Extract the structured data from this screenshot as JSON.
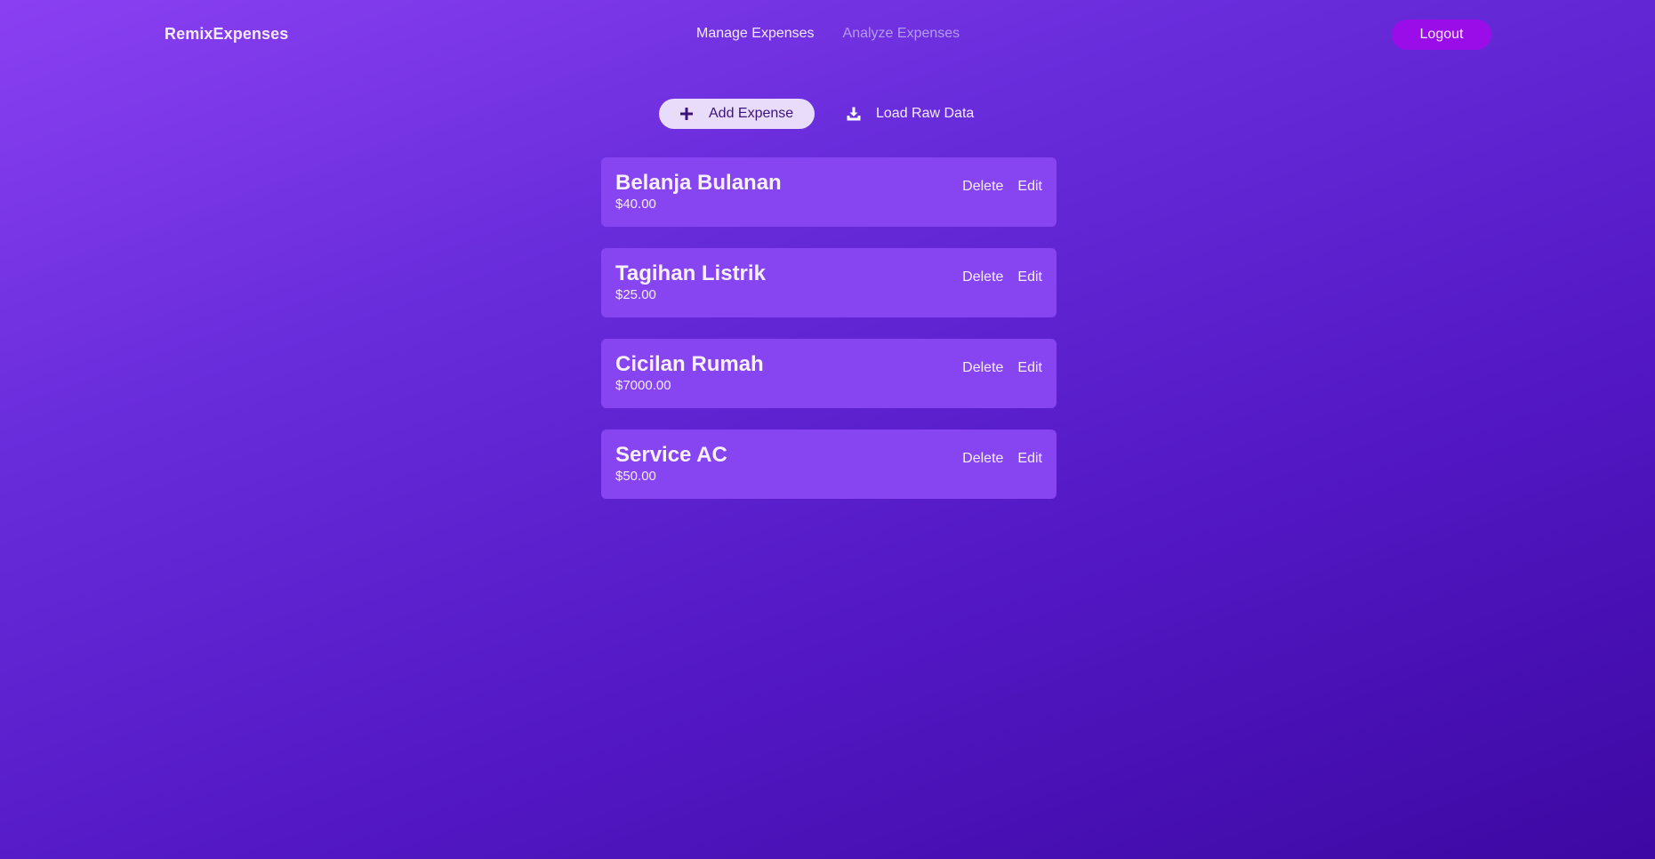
{
  "header": {
    "brand": "RemixExpenses",
    "nav": [
      {
        "label": "Manage Expenses"
      },
      {
        "label": "Analyze Expenses"
      }
    ],
    "logout_label": "Logout"
  },
  "toolbar": {
    "add_label": "Add Expense",
    "add_icon": "plus-icon",
    "load_label": "Load Raw Data",
    "load_icon": "download-icon"
  },
  "expenses": [
    {
      "title": "Belanja Bulanan",
      "amount": "$40.00",
      "delete_label": "Delete",
      "edit_label": "Edit"
    },
    {
      "title": "Tagihan Listrik",
      "amount": "$25.00",
      "delete_label": "Delete",
      "edit_label": "Edit"
    },
    {
      "title": "Cicilan Rumah",
      "amount": "$7000.00",
      "delete_label": "Delete",
      "edit_label": "Edit"
    },
    {
      "title": "Service AC",
      "amount": "$50.00",
      "delete_label": "Delete",
      "edit_label": "Edit"
    }
  ],
  "colors": {
    "accent": "#9b0de8",
    "card": "#8745f2",
    "add_button": "#e9dcfb"
  }
}
